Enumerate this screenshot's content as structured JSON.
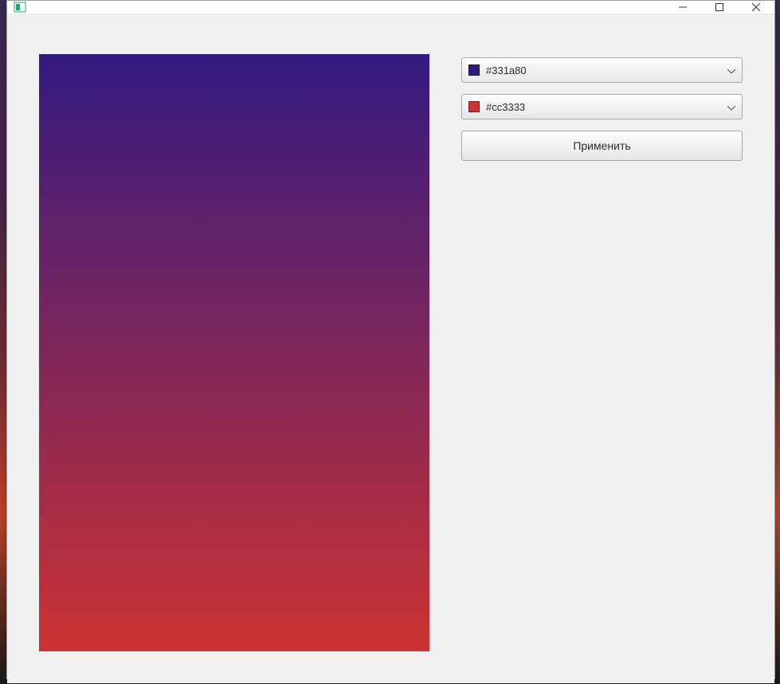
{
  "window": {
    "title": ""
  },
  "gradient": {
    "start": "#331a80",
    "end": "#cc3333"
  },
  "controls": {
    "color1_label": "#331a80",
    "color1_swatch": "#331a80",
    "color2_label": "#cc3333",
    "color2_swatch": "#cc3333",
    "apply_label": "Применить"
  }
}
